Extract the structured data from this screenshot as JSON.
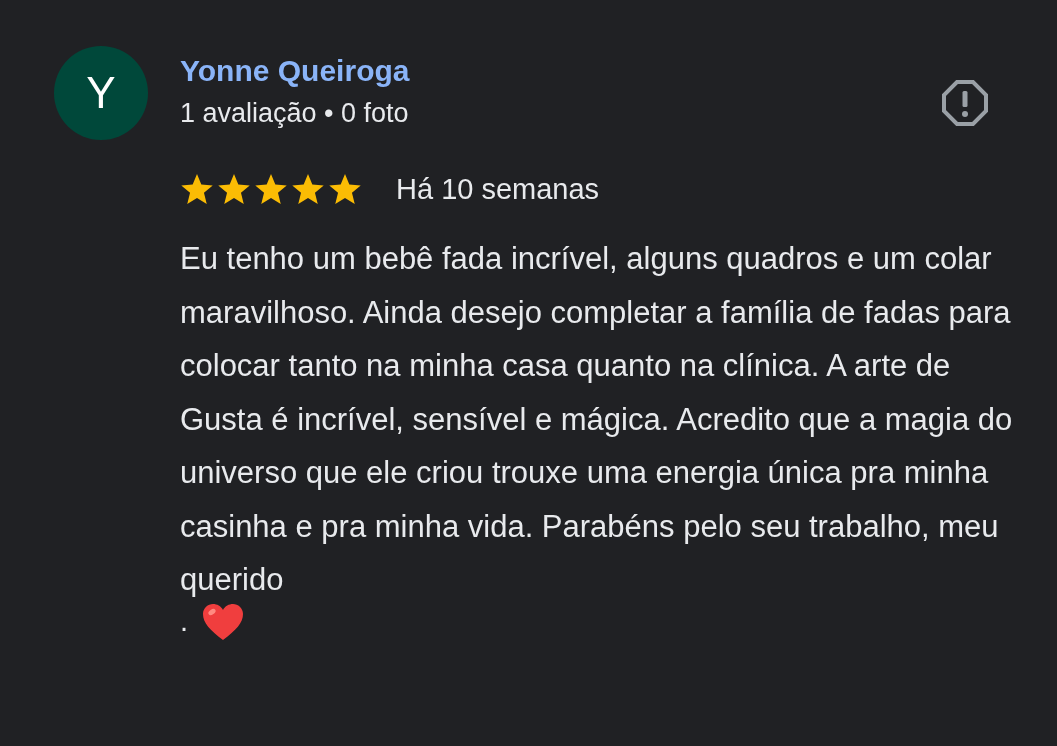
{
  "reviewer": {
    "initial": "Y",
    "name": "Yonne Queiroga",
    "stats": "1 avaliação • 0 foto"
  },
  "review": {
    "stars": 5,
    "time": "Há 10 semanas",
    "text": "Eu tenho um bebê fada incrível, alguns quadros e um colar maravilhoso. Ainda desejo completar a família de fadas para colocar tanto na minha casa quanto na clínica. A arte de Gusta é incrível, sensível e mágica. Acredito que a magia do universo que ele criou trouxe uma energia única pra minha casinha e pra minha vida. Parabéns pelo seu trabalho, meu querido",
    "ending": "."
  }
}
